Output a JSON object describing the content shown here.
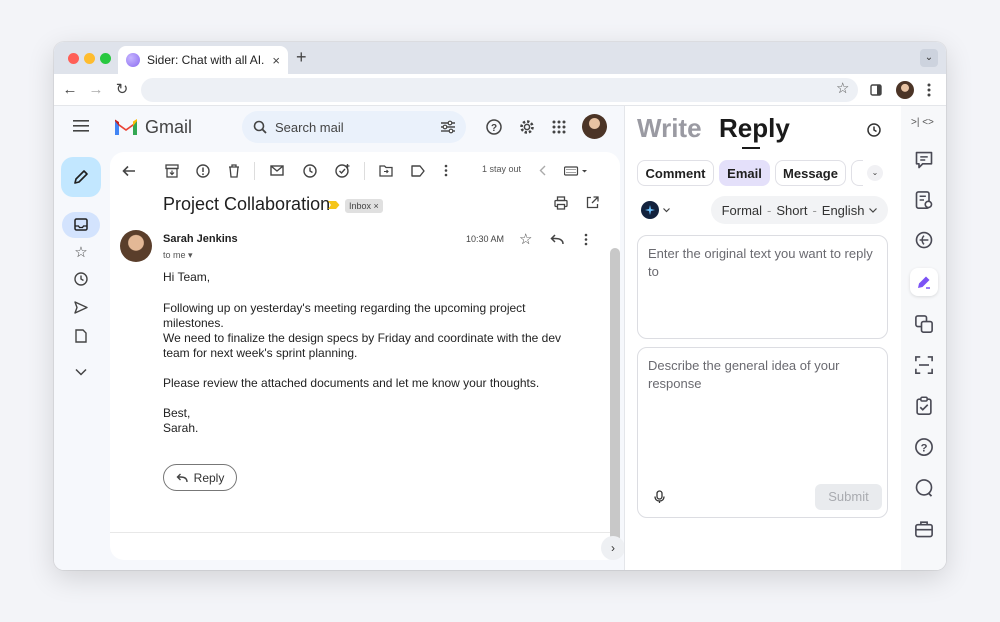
{
  "browser": {
    "tab_title": "Sider: Chat with all AI...",
    "tab_close": "×",
    "new_tab": "+",
    "tab_menu": "⌄",
    "nav": {
      "back": "←",
      "forward": "→",
      "reload": "↻"
    },
    "star": "☆"
  },
  "gmail": {
    "brand": "Gmail",
    "search_placeholder": "Search mail",
    "toolbar": {
      "stay_out": "1 stay out"
    },
    "email": {
      "subject": "Project Collaboration",
      "label": "Inbox",
      "label_close": "×",
      "sender": "Sarah Jenkins",
      "to": "to me",
      "time": "10:30 AM",
      "body": [
        "Hi Team,",
        "Following up on yesterday's meeting regarding the upcoming project milestones.",
        "We need to finalize the design specs by Friday and coordinate with the dev team for next week's sprint planning.",
        "Please review the attached documents and let me know your thoughts.",
        "Best,\nSarah."
      ],
      "reply_button": "Reply"
    }
  },
  "sider": {
    "tabs": {
      "write": "Write",
      "reply": "Reply"
    },
    "chips": {
      "comment": "Comment",
      "email": "Email",
      "message": "Message"
    },
    "options": {
      "tone": "Formal",
      "length": "Short",
      "language": "English",
      "sep": "-"
    },
    "original_placeholder": "Enter the original text you want to reply to",
    "idea_placeholder": "Describe the general idea of your response",
    "submit": "Submit",
    "rail_top": ">|  <>"
  },
  "colors": {
    "accent": "#c2e7ff",
    "email_chip": "#e4e0fa",
    "submit_bg": "#e9ebee"
  }
}
